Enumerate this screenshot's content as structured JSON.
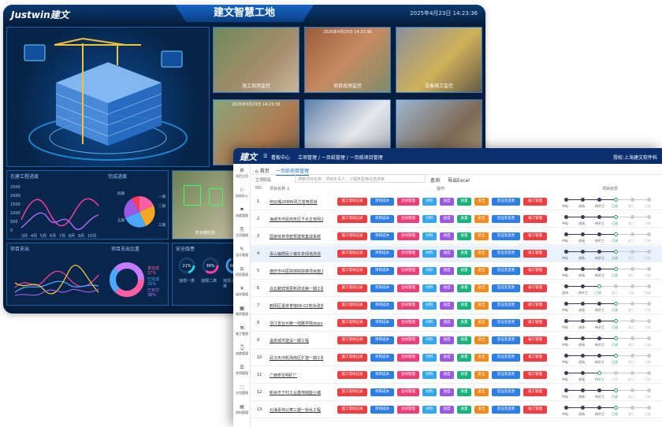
{
  "dashboard": {
    "logo": "Justwin建文",
    "title": "建文智慧工地",
    "datetime": "2025年4月23日   14:23:36",
    "cams": [
      {
        "label": "施工现场监控",
        "time": ""
      },
      {
        "label": "项目现场监控",
        "time": "2025年4月23日 14:23:36"
      },
      {
        "label": "设备施工监控",
        "time": ""
      },
      {
        "label": "",
        "time": "2025年4月23日 14:23:36"
      },
      {
        "label": "",
        "time": ""
      },
      {
        "label": "",
        "time": ""
      }
    ],
    "panels": {
      "progress": "在建工程进度",
      "completion": "完成进度",
      "expenditure": "项目支出",
      "ratio": "项目支出比重",
      "safety": "安全隐患"
    },
    "months": [
      "3月",
      "4月",
      "5月",
      "6月",
      "7月",
      "8月",
      "9月",
      "10月"
    ],
    "yticks": [
      "2500",
      "2000",
      "1500",
      "1000",
      "500",
      "0"
    ],
    "ratio_legend": [
      {
        "label": "未完成 37%",
        "color": "#ff5fa2"
      },
      {
        "label": "已完成 25%",
        "color": "#4aa8ff"
      },
      {
        "label": "已支付 38%",
        "color": "#c67bff"
      }
    ],
    "safety_items": [
      "21%",
      "36%",
      "68%"
    ],
    "safety_labels": [
      "违规一类",
      "违规二类",
      "违规三类"
    ],
    "completion_legend": [
      "一期",
      "二期",
      "三期",
      "四期",
      "五期"
    ],
    "face_label": "安全帽检测"
  },
  "app": {
    "brand": "建文",
    "topbar": {
      "menu": "看板中心",
      "breadcrumb": "立项管理  /  一页纸管理  /  一页纸项目管理",
      "right": "授权:上海建文软件科"
    },
    "sidebar": [
      {
        "label": "项目立项",
        "icon": "⚙"
      },
      {
        "label": "协同办公",
        "icon": "⚐"
      },
      {
        "label": "进度管理",
        "icon": "⚑"
      },
      {
        "label": "立项管理",
        "icon": "⎘"
      },
      {
        "label": "设计管理",
        "icon": "✎"
      },
      {
        "label": "招投管理",
        "icon": "⚖"
      },
      {
        "label": "成本管理",
        "icon": "¥"
      },
      {
        "label": "物资管理",
        "icon": "▦"
      },
      {
        "label": "施工管理",
        "icon": "⚒"
      },
      {
        "label": "进度管理",
        "icon": "⌚"
      },
      {
        "label": "合同管理",
        "icon": "☰"
      },
      {
        "label": "分包管理",
        "icon": "⬚"
      },
      {
        "label": "资料管理",
        "icon": "▤"
      }
    ],
    "tabs": {
      "home": "首页",
      "active": "一页纸项目管理"
    },
    "filter": {
      "label": "立项阶段",
      "placeholder": "搜索项目名称、项目负责人、工程类型等信息搜索",
      "query": "查询",
      "export": "导出Excel"
    },
    "headers": {
      "no": "NO.",
      "name": "项目名称 ↕",
      "ops": "操作",
      "status": "项目状态"
    },
    "buttons": [
      {
        "label": "施工现场记录",
        "color": "#ee3e44"
      },
      {
        "label": "项目成本",
        "color": "#2f7ee8"
      },
      {
        "label": "合同管理",
        "color": "#ee3e77"
      },
      {
        "label": "材料",
        "color": "#35a7ee"
      },
      {
        "label": "进度",
        "color": "#9b58e2"
      },
      {
        "label": "质量",
        "color": "#1bb37b"
      },
      {
        "label": "安全",
        "color": "#f28a1e"
      },
      {
        "label": "签证及变更",
        "color": "#2f7ee8"
      },
      {
        "label": "竣工管理",
        "color": "#ee3e44"
      }
    ],
    "row_status": [
      [
        "中标",
        "进场",
        "待开工",
        "已进",
        "竣工",
        "已结"
      ],
      [
        "中标",
        "进场",
        "待开工",
        "已进",
        "竣工",
        "已结"
      ],
      [
        "中标",
        "进场",
        "待开工",
        "已进",
        "竣工",
        "已结"
      ],
      [
        "中标",
        "进场",
        "待开工",
        "已进",
        "竣工",
        "已结"
      ],
      [
        "中标",
        "进场",
        "待开工",
        "已进",
        "竣工",
        "已结"
      ],
      [
        "进场",
        "待开工",
        "已进",
        "竣工",
        "已结",
        "完成"
      ],
      [
        "中标",
        "进场",
        "待开工",
        "已进",
        "竣工",
        "已结"
      ],
      [
        "中标",
        "进场",
        "待开工",
        "已进",
        "竣工",
        "已结"
      ],
      [
        "中标",
        "进场",
        "待开工",
        "已进",
        "竣工",
        "已结"
      ],
      [
        "中标",
        "进场",
        "待开工",
        "已进",
        "竣工",
        "已结"
      ],
      [
        "中标",
        "进场",
        "待开工",
        "已进",
        "竣工",
        "已结"
      ],
      [
        "中标",
        "进场",
        "待开工",
        "已进",
        "竣工",
        "已结"
      ],
      [
        "中标",
        "进场",
        "待开工",
        "已进",
        "竣工",
        "已结"
      ]
    ],
    "row_progress": [
      4,
      4,
      4,
      4,
      4,
      3,
      4,
      4,
      4,
      4,
      3,
      4,
      4
    ],
    "rows": [
      {
        "no": "1",
        "name": "阿云嘎20MW风力发电项目"
      },
      {
        "no": "2",
        "name": "海城市市民商务区下水主管网工程"
      },
      {
        "no": "3",
        "name": "国家体育场智慧建筑集成系统"
      },
      {
        "no": "4",
        "name": "青山镇居民小镇东泉绿道改造"
      },
      {
        "no": "5",
        "name": "德庆市中医院感院院楼项目施工"
      },
      {
        "no": "6",
        "name": "白云鹏宾馆更新改造第一期工程"
      },
      {
        "no": "7",
        "name": "鹤阳区嘉体育馆06-02地块改造"
      },
      {
        "no": "8",
        "name": "浙江省台州第一线路学院dopo"
      },
      {
        "no": "9",
        "name": "温泉城市建设一期工程"
      },
      {
        "no": "10",
        "name": "武汉天河机场南区扩建一期工程"
      },
      {
        "no": "11",
        "name": "广西奇龙明矿厂"
      },
      {
        "no": "12",
        "name": "新余市下村工业基地储能小镇"
      },
      {
        "no": "13",
        "name": "北海青伟公寓三期一标水工程"
      }
    ]
  },
  "colors": {
    "done": "#23a35a",
    "current": "#23a35a",
    "pending": "#3b3b55",
    "future": "#c9c9c9"
  }
}
